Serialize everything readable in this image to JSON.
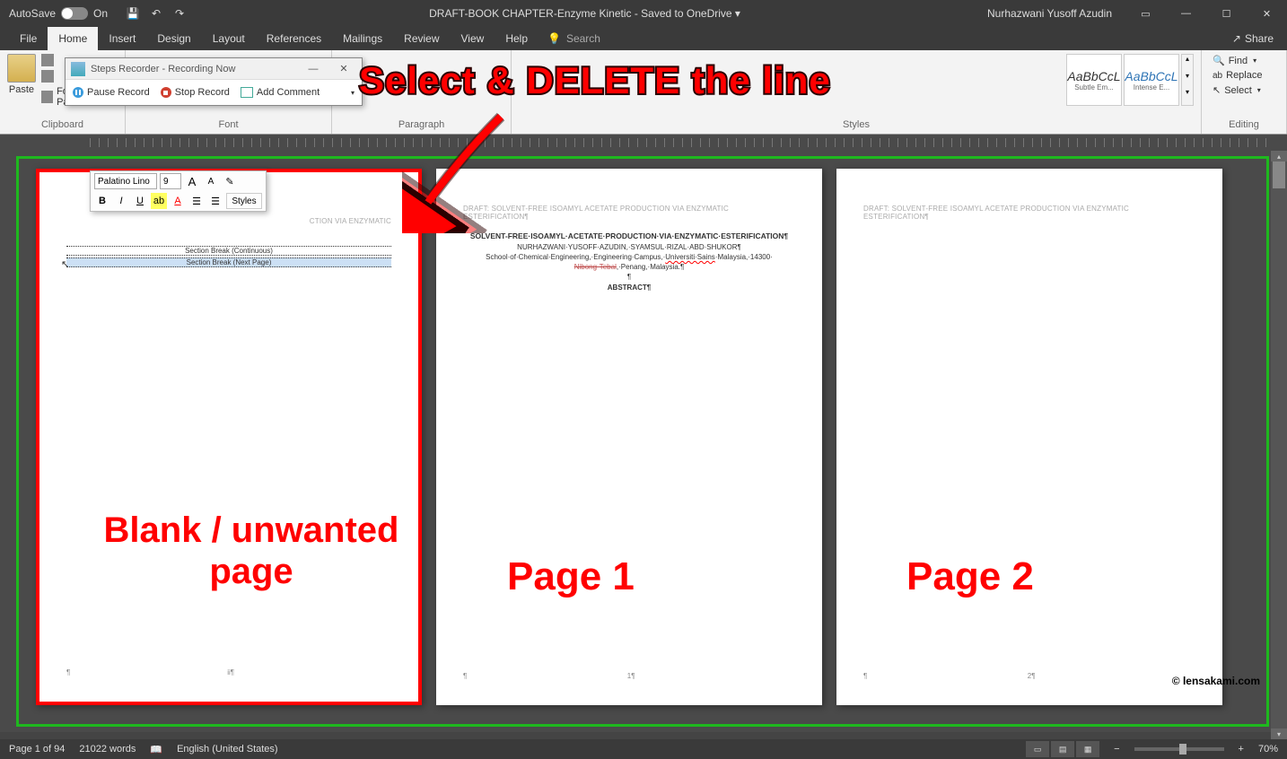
{
  "titlebar": {
    "autosave_label": "AutoSave",
    "autosave_state": "On",
    "doc_title": "DRAFT-BOOK CHAPTER-Enzyme Kinetic  -  Saved to OneDrive ▾",
    "user_name": "Nurhazwani Yusoff Azudin"
  },
  "tabs": {
    "file": "File",
    "home": "Home",
    "insert": "Insert",
    "design": "Design",
    "layout": "Layout",
    "references": "References",
    "mailings": "Mailings",
    "review": "Review",
    "view": "View",
    "help": "Help",
    "search": "Search",
    "share": "Share"
  },
  "ribbon": {
    "clipboard": {
      "label": "Clipboard",
      "paste": "Paste",
      "format_painter": "Format Painter"
    },
    "font": {
      "label": "Font"
    },
    "paragraph": {
      "label": "Paragraph"
    },
    "styles": {
      "label": "Styles",
      "items": [
        {
          "preview": "AaBbCcL",
          "name": "Subtle Em..."
        },
        {
          "preview": "AaBbCcL",
          "name": "Intense E..."
        }
      ]
    },
    "editing": {
      "label": "Editing",
      "find": "Find",
      "replace": "Replace",
      "select": "Select"
    }
  },
  "recorder": {
    "title": "Steps Recorder - Recording Now",
    "pause": "Pause Record",
    "stop": "Stop Record",
    "comment": "Add Comment"
  },
  "mini_toolbar": {
    "font": "Palatino Lino",
    "size": "9",
    "styles": "Styles"
  },
  "pages": {
    "header": "DRAFT: SOLVENT-FREE ISOAMYL ACETATE PRODUCTION VIA ENZYMATIC ESTERIFICATION¶",
    "header_p1_partial": "CTION VIA ENZYMATIC",
    "section_break_cont": "Section Break (Continuous)",
    "section_break_next": "Section Break (Next Page)",
    "title": "SOLVENT-FREE·ISOAMYL·ACETATE·PRODUCTION·VIA·ENZYMATIC·ESTERIFICATION¶",
    "authors": "NURHAZWANI·YUSOFF·AZUDIN,·SYAMSUL·RIZAL·ABD·SHUKOR¶",
    "affil1": "School·of·Chemical·Engineering,·Engineering·Campus,·",
    "affil_uni": "Universiti·Sains",
    "affil2": "·Malaysia,·14300·",
    "affil_city": "Nibong·Tebal",
    "affil3": ",·Penang,·Malaysia.¶",
    "abstract": "ABSTRACT¶",
    "pilcrow": "¶",
    "page_num_blank": "ii¶",
    "page_num_1": "1¶",
    "page_num_2": "2¶"
  },
  "annotations": {
    "main": "Select & DELETE the line",
    "blank": "Blank / unwanted page",
    "p1": "Page 1",
    "p2": "Page 2",
    "watermark": "© lensakami.com"
  },
  "status": {
    "page": "Page 1 of 94",
    "words": "21022 words",
    "lang": "English (United States)",
    "zoom": "70%"
  }
}
